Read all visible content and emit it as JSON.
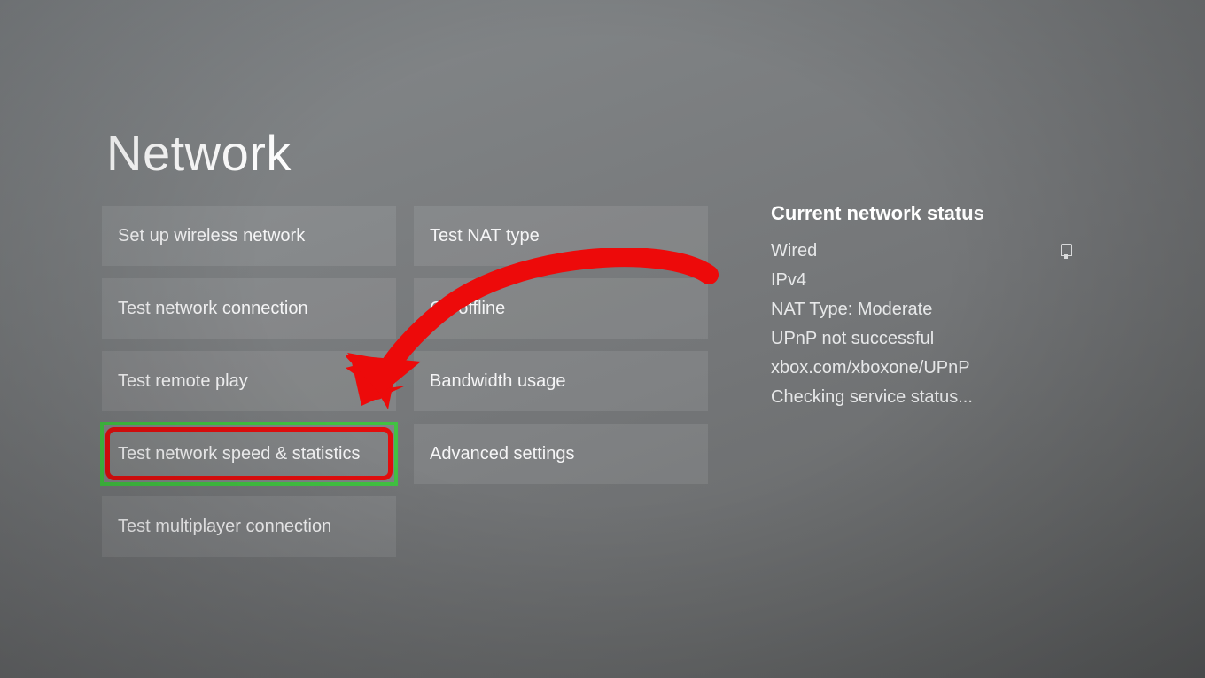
{
  "title": "Network",
  "col1": [
    {
      "id": "setup-wireless",
      "label": "Set up wireless network",
      "highlight": false
    },
    {
      "id": "test-network-connection",
      "label": "Test network connection",
      "highlight": false
    },
    {
      "id": "test-remote-play",
      "label": "Test remote play",
      "highlight": false
    },
    {
      "id": "test-speed-stats",
      "label": "Test network speed & statistics",
      "highlight": true
    },
    {
      "id": "test-multiplayer",
      "label": "Test multiplayer connection",
      "highlight": false
    }
  ],
  "col2": [
    {
      "id": "test-nat-type",
      "label": "Test NAT type"
    },
    {
      "id": "go-offline",
      "label": "Go offline"
    },
    {
      "id": "bandwidth-usage",
      "label": "Bandwidth usage"
    },
    {
      "id": "advanced-settings",
      "label": "Advanced settings"
    }
  ],
  "status": {
    "heading": "Current network status",
    "connection": "Wired",
    "ip": "IPv4",
    "nat": "NAT Type: Moderate",
    "upnp": "UPnP not successful",
    "upnp_url": "xbox.com/xboxone/UPnP",
    "service": "Checking service status..."
  },
  "annotation": {
    "arrow_color": "#ed0a0a",
    "highlight_outer": "#41c241",
    "highlight_inner": "#e30d0d"
  }
}
